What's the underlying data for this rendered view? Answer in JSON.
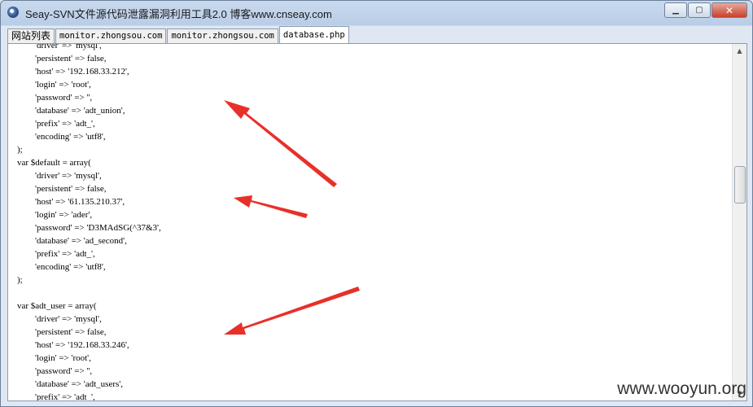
{
  "window": {
    "title": "Seay-SVN文件源代码泄露漏洞利用工具2.0  博客www.cnseay.com",
    "controls": {
      "minimize": "▁",
      "maximize": "▢",
      "close": "✕"
    }
  },
  "tabs": [
    {
      "label": "网站列表",
      "active": false
    },
    {
      "label": "monitor.zhongsou.com",
      "active": false
    },
    {
      "label": "monitor.zhongsou.com",
      "active": false
    },
    {
      "label": "database.php",
      "active": true
    }
  ],
  "code_lines": [
    "            'driver' => 'mysql',",
    "            'persistent' => false,",
    "            'host' => '192.168.33.212',",
    "            'login' => 'root',",
    "            'password' => '',",
    "            'database' => 'adt_union',",
    "            'prefix' => 'adt_',",
    "            'encoding' => 'utf8',",
    "    );",
    "    var $default = array(",
    "            'driver' => 'mysql',",
    "            'persistent' => false,",
    "            'host' => '61.135.210.37',",
    "            'login' => 'ader',",
    "            'password' => 'D3MAdSG(^37&3',",
    "            'database' => 'ad_second',",
    "            'prefix' => 'adt_',",
    "            'encoding' => 'utf8',",
    "    );",
    "",
    "    var $adt_user = array(",
    "            'driver' => 'mysql',",
    "            'persistent' => false,",
    "            'host' => '192.168.33.246',",
    "            'login' => 'root',",
    "            'password' => '',",
    "            'database' => 'adt_users',",
    "            'prefix' => 'adt_',"
  ],
  "watermark": "www.wooyun.org",
  "colors": {
    "arrow": "#e8302a"
  }
}
